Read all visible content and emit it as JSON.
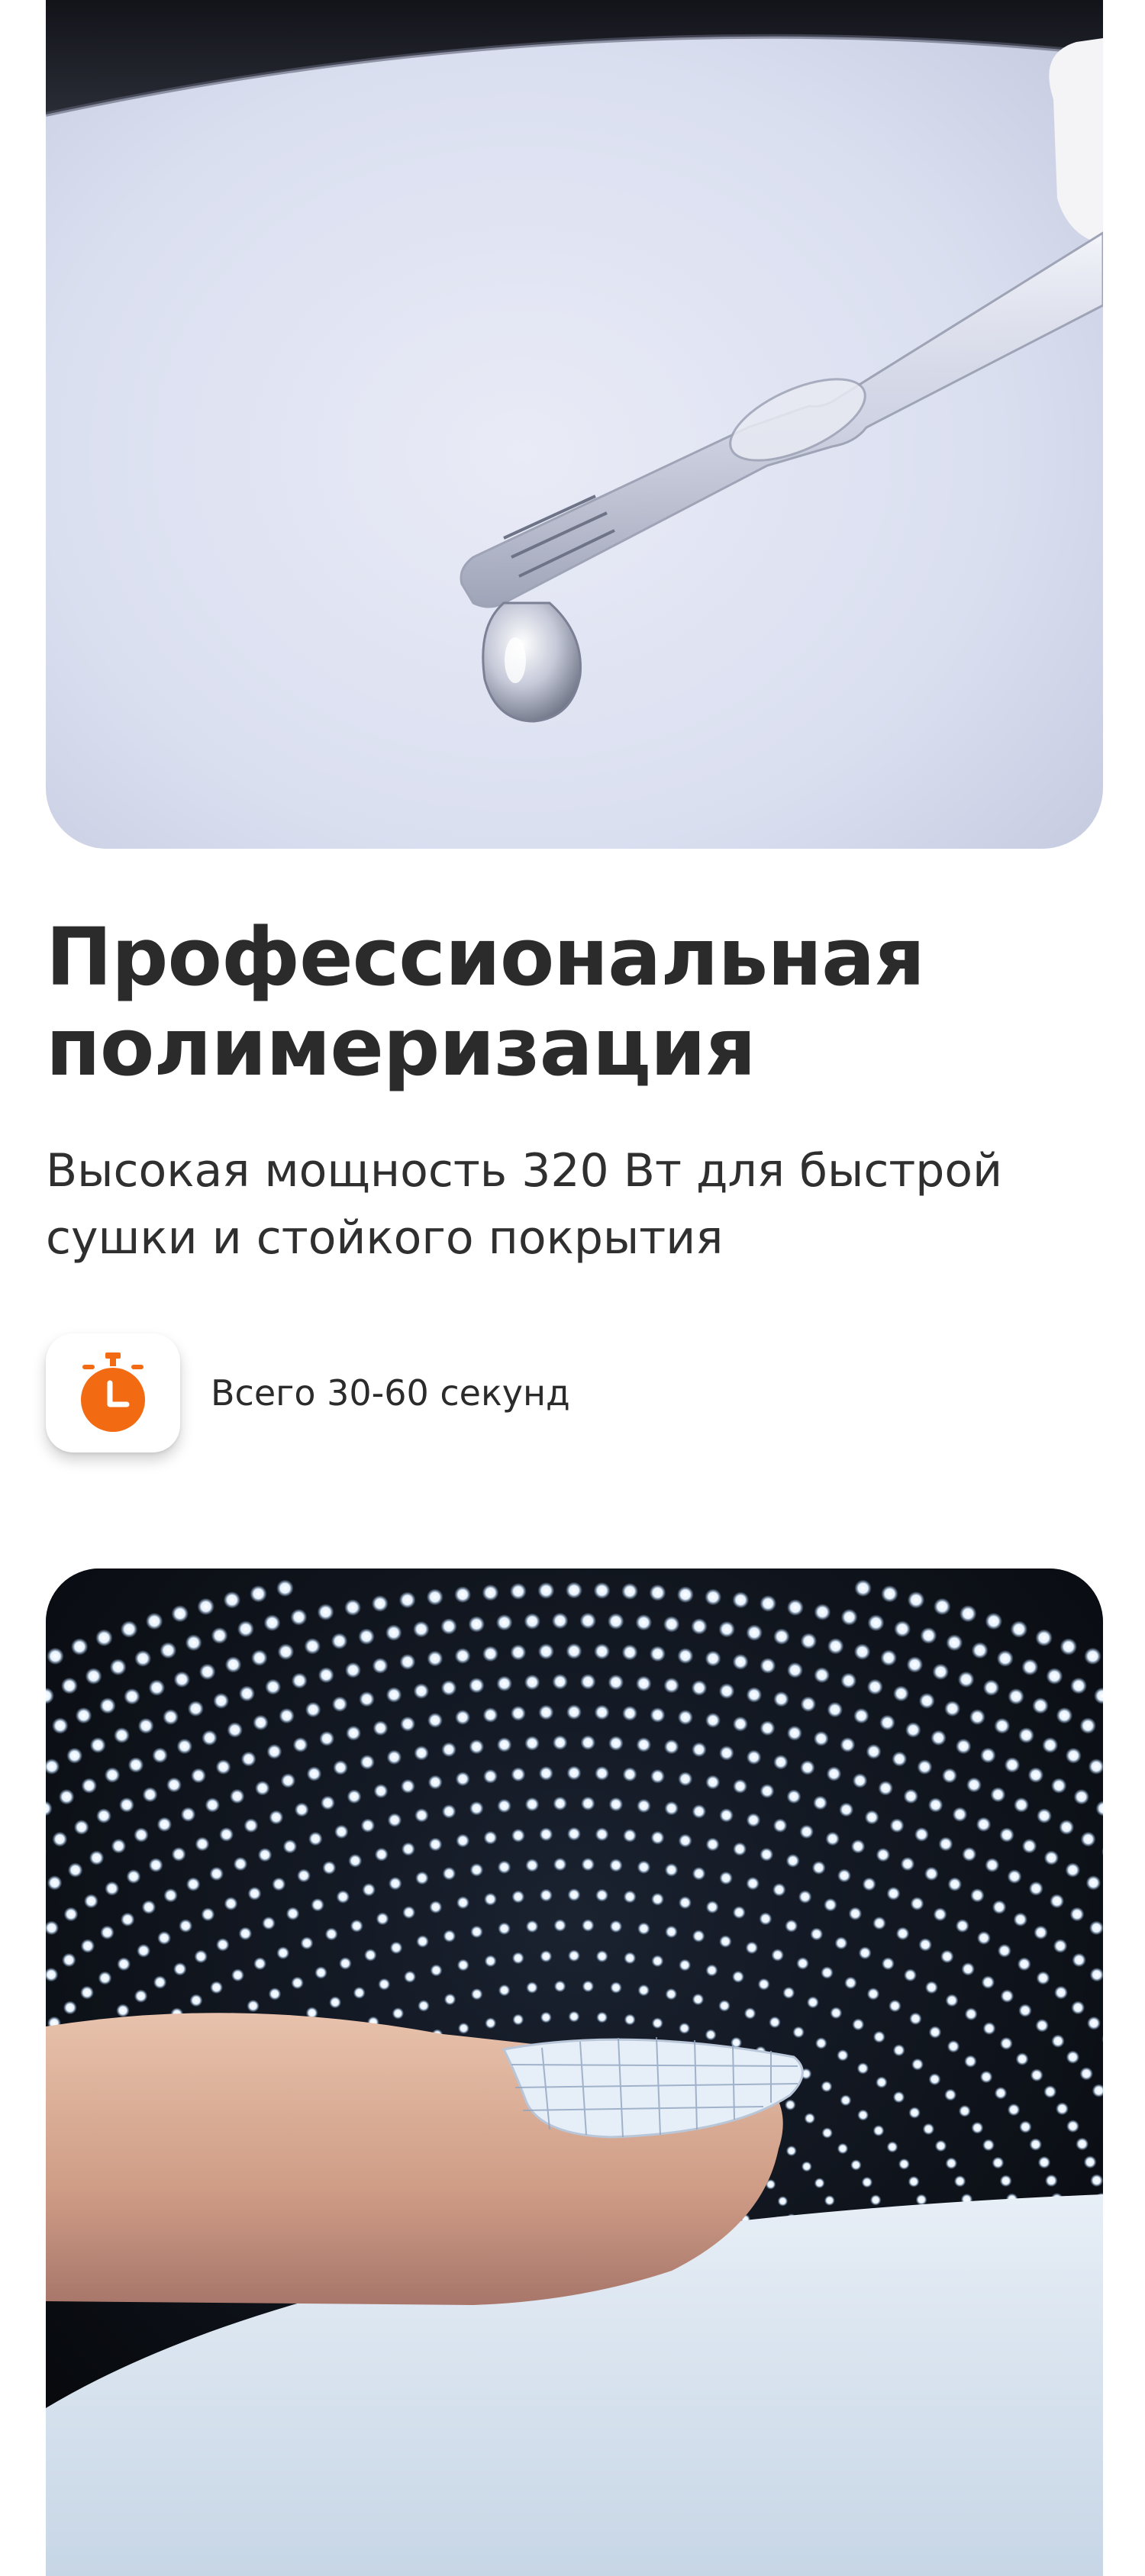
{
  "hero_image": {
    "icon": "pipette-drop-photo"
  },
  "section": {
    "title_line1": "Профессиональная",
    "title_line2": "полимеризация",
    "subtitle_line1": "Высокая мощность 320 Вт для быстрой",
    "subtitle_line2": "сушки и стойкого покрытия"
  },
  "feature": {
    "icon": "stopwatch-icon",
    "text": "Всего 30-60 секунд",
    "accent_color": "#f26a12"
  },
  "bottom_image": {
    "icon": "led-lamp-finger-photo"
  }
}
